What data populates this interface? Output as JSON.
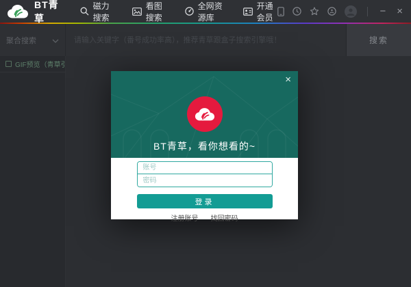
{
  "app": {
    "title": "BT青草"
  },
  "titlebar": {
    "nav": [
      {
        "label": "磁力搜索",
        "icon": "magnifier-icon"
      },
      {
        "label": "看图搜索",
        "icon": "picture-icon"
      },
      {
        "label": "全网资源库",
        "icon": "compass-icon"
      },
      {
        "label": "开通会员",
        "icon": "id-card-icon"
      }
    ],
    "status_icons": [
      "phone-icon",
      "clock-icon",
      "star-icon",
      "circled-dot-icon",
      "avatar"
    ],
    "window_controls": {
      "minimize": "−",
      "close": "×"
    }
  },
  "search": {
    "engine_dropdown": {
      "selected": "聚合搜索"
    },
    "input_placeholder": "请输入关键字（番号成功率高），推荐青草跟盒子搜索引擎哦！",
    "button_label": "搜索"
  },
  "sidebar": {
    "gif_preview": {
      "label": "GIF预览（青草引擎）",
      "checked": false
    }
  },
  "login_modal": {
    "close": "×",
    "title": "BT青草，看你想看的~",
    "account_placeholder": "账号",
    "password_placeholder": "密码",
    "login_button": "登录",
    "links": {
      "register": "注册账号",
      "recover": "找回密码"
    }
  },
  "colors": {
    "titlebar_bg": "#2f3135",
    "modal_header_teal": "#17695f",
    "accent_teal": "#139c94",
    "input_border_teal": "#2fa89f",
    "brand_red": "#e51a3e",
    "logo_leaf_green": "#3aa05a",
    "gif_label_green": "#5d7f6a",
    "rainbow": [
      "#8a140e",
      "#c83c00",
      "#d7a800",
      "#a3b800",
      "#4aa34a",
      "#24a06c",
      "#17988f",
      "#1d7fc4",
      "#5a3bc8",
      "#9330b4",
      "#c2245f",
      "#8c1a22"
    ]
  }
}
